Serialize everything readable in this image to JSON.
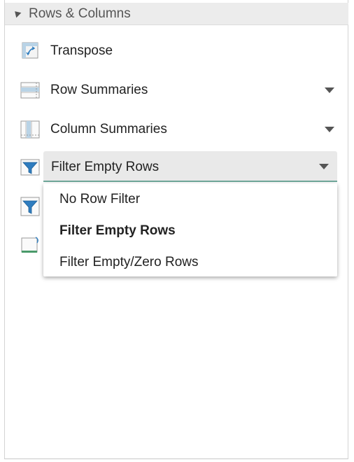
{
  "section": {
    "title": "Rows & Columns"
  },
  "items": [
    {
      "label": "Transpose",
      "icon": "transpose-icon",
      "has_dropdown": false
    },
    {
      "label": "Row Summaries",
      "icon": "row-summaries-icon",
      "has_dropdown": true
    },
    {
      "label": "Column Summaries",
      "icon": "column-summaries-icon",
      "has_dropdown": true
    }
  ],
  "filter_combo": {
    "icon": "filter-icon",
    "selected": "Filter Empty Rows",
    "options": [
      "No Row Filter",
      "Filter Empty Rows",
      "Filter Empty/Zero Rows"
    ],
    "accent_color": "#6fa79a"
  },
  "hidden_items": [
    {
      "icon": "filter-columns-icon"
    },
    {
      "icon": "insert-sheet-icon"
    }
  ]
}
